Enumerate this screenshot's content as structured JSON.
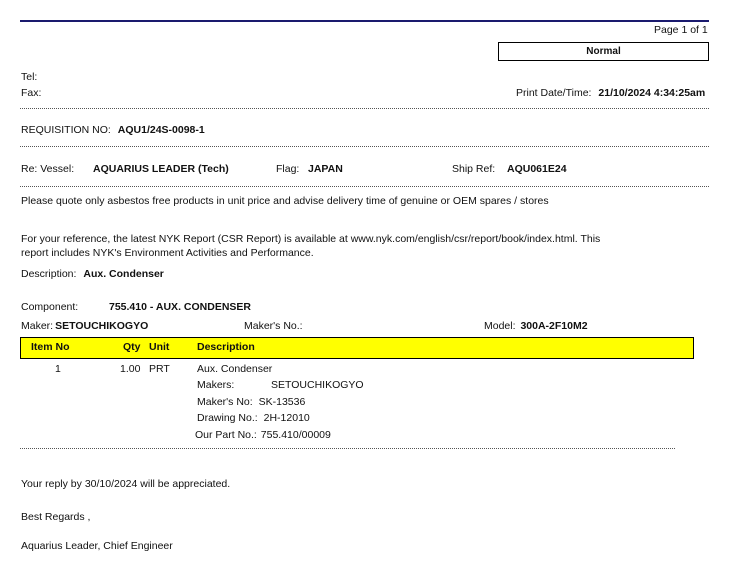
{
  "header": {
    "page": "Page 1 of 1",
    "priority": "Normal",
    "tel_label": "Tel:",
    "fax_label": "Fax:",
    "print_label": "Print Date/Time:",
    "print_value": "21/10/2024  4:34:25am"
  },
  "requisition": {
    "label": "REQUISITION NO:",
    "value": "AQU1/24S-0098-1"
  },
  "vessel": {
    "re_label": "Re: Vessel:",
    "name": "AQUARIUS LEADER (Tech)",
    "flag_label": "Flag:",
    "flag": "JAPAN",
    "shipref_label": "Ship Ref:",
    "shipref": "AQU061E24"
  },
  "notes": {
    "quote": "Please quote only asbestos free products in unit price and advise delivery time of genuine or OEM spares / stores",
    "nyk_line1": "For your reference, the latest NYK Report (CSR Report) is available at www.nyk.com/english/csr/report/book/index.html. This",
    "nyk_line2": "report includes NYK's Environment Activities and Performance."
  },
  "description": {
    "label": "Description:",
    "value": "Aux. Condenser"
  },
  "component": {
    "label": "Component:",
    "value": "755.410 - AUX. CONDENSER",
    "maker_label": "Maker:",
    "maker": "SETOUCHIKOGYO",
    "makers_no_label": "Maker's No.:",
    "model_label": "Model:",
    "model": "300A-2F10M2"
  },
  "table": {
    "headers": [
      "Item No",
      "Qty",
      "Unit",
      "Description"
    ],
    "rows": [
      {
        "item": "1",
        "qty": "1.00",
        "unit": "PRT",
        "desc": "Aux. Condenser",
        "makers_label": "Makers:",
        "makers": "SETOUCHIKOGYO",
        "makers_no_label": "Maker's No:",
        "makers_no": "SK-13536",
        "drawing_label": "Drawing No.:",
        "drawing": "2H-12010",
        "part_label": "Our Part No.:",
        "part": "755.410/00009"
      }
    ]
  },
  "footer": {
    "reply": "Your reply by 30/10/2024 will be appreciated.",
    "regards": "Best Regards ,",
    "signature": "Aquarius Leader, Chief Engineer"
  },
  "colors": {
    "header_fill": "#ffff00",
    "top_rule": "#1a1a6e"
  }
}
